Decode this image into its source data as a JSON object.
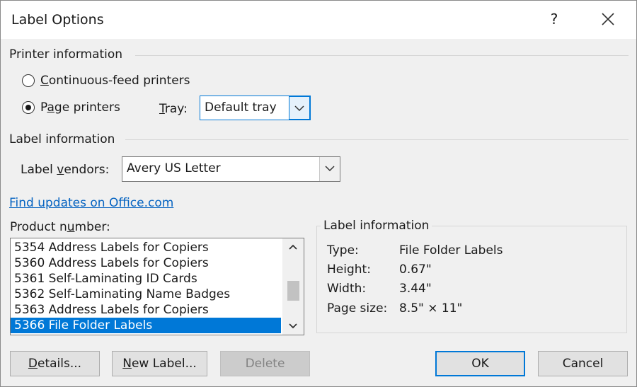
{
  "window": {
    "title": "Label Options",
    "help_glyph": "?",
    "close_icon": "close-icon"
  },
  "printer_info": {
    "group_label": "Printer information",
    "continuous_label_pre": "",
    "continuous_label_u": "C",
    "continuous_label_post": "ontinuous-feed printers",
    "page_label_pre": "P",
    "page_label_u": "a",
    "page_label_post": "ge printers",
    "selected": "page",
    "tray_label_u": "T",
    "tray_label_post": "ray:",
    "tray_value": "Default tray"
  },
  "label_info": {
    "group_label": "Label information",
    "vendors_label_pre": "Label ",
    "vendors_label_u": "v",
    "vendors_label_post": "endors:",
    "vendor_value": "Avery US Letter"
  },
  "updates_link": "Find updates on Office.com",
  "product": {
    "label_pre": "Product n",
    "label_u": "u",
    "label_post": "mber:",
    "items": [
      "5354 Address Labels for Copiers",
      "5360 Address Labels for Copiers",
      "5361 Self-Laminating ID Cards",
      "5362 Self-Laminating Name Badges",
      "5363 Address Labels for Copiers",
      "5366 File Folder Labels"
    ],
    "selected_index": 5
  },
  "details_panel": {
    "title": "Label information",
    "type_label": "Type:",
    "type_value": "File Folder Labels",
    "height_label": "Height:",
    "height_value": "0.67\"",
    "width_label": "Width:",
    "width_value": "3.44\"",
    "page_size_label": "Page size:",
    "page_size_value": "8.5\" × 11\""
  },
  "buttons": {
    "details_u": "D",
    "details_post": "etails...",
    "new_label_u": "N",
    "new_label_post": "ew Label...",
    "delete": "Delete",
    "ok": "OK",
    "cancel": "Cancel"
  },
  "colors": {
    "accent": "#0078d7",
    "link": "#0563c1"
  }
}
